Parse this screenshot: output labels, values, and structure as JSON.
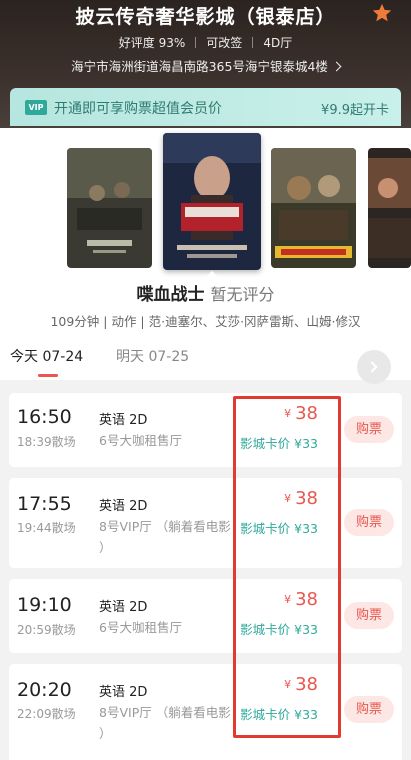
{
  "cinema": {
    "name": "披云传奇奢华影城（银泰店）",
    "rating": "好评度 93%",
    "tag_rebook": "可改签",
    "tag_4d": "4D厅",
    "address": "海宁市海洲街道海昌南路365号海宁银泰城4楼"
  },
  "vip": {
    "badge": "VIP",
    "text": "开通即可享购票超值会员价",
    "price": "¥9.9起开卡"
  },
  "movie": {
    "name": "喋血战士",
    "score": "暂无评分",
    "info": "109分钟 | 动作 | 范·迪塞尔、艾莎·冈萨雷斯、山姆·修汉"
  },
  "dates": [
    {
      "label": "今天 07-24"
    },
    {
      "label": "明天 07-25"
    }
  ],
  "showtimes": [
    {
      "time": "16:50",
      "end": "18:39散场",
      "lang": "英语 2D",
      "hall": "6号大咖租售厅",
      "hall2": "",
      "yen": "¥",
      "price": "38",
      "member": "影城卡价 ¥33",
      "buy": "购票"
    },
    {
      "time": "17:55",
      "end": "19:44散场",
      "lang": "英语 2D",
      "hall": "8号VIP厅 （躺着看电影",
      "hall2": "）",
      "yen": "¥",
      "price": "38",
      "member": "影城卡价 ¥33",
      "buy": "购票"
    },
    {
      "time": "19:10",
      "end": "20:59散场",
      "lang": "英语 2D",
      "hall": "6号大咖租售厅",
      "hall2": "",
      "yen": "¥",
      "price": "38",
      "member": "影城卡价 ¥33",
      "buy": "购票"
    },
    {
      "time": "20:20",
      "end": "22:09散场",
      "lang": "英语 2D",
      "hall": "8号VIP厅 （躺着看电影",
      "hall2": "）",
      "yen": "¥",
      "price": "38",
      "member": "影城卡价 ¥33",
      "buy": "购票"
    }
  ],
  "colors": {
    "accent": "#e8584f",
    "teal": "#2ea99a",
    "star": "#f07a3a",
    "highlight": "#e23a30"
  }
}
